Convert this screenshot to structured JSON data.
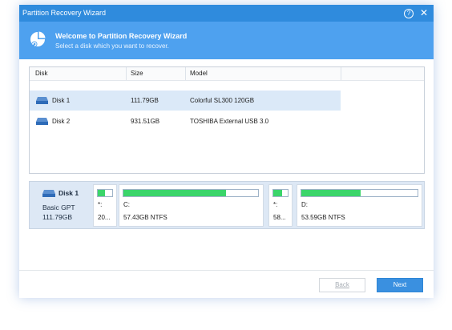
{
  "window": {
    "title": "Partition Recovery Wizard",
    "help_glyph": "?",
    "close_glyph": "✕"
  },
  "header": {
    "title": "Welcome to Partition Recovery Wizard",
    "subtitle": "Select a disk which you want to recover."
  },
  "table": {
    "columns": [
      "Disk",
      "Size",
      "Model"
    ],
    "rows": [
      {
        "disk": "Disk 1",
        "size": "111.79GB",
        "model": "Colorful SL300 120GB",
        "selected": true
      },
      {
        "disk": "Disk 2",
        "size": "931.51GB",
        "model": "TOSHIBA External USB 3.0",
        "selected": false
      }
    ]
  },
  "disk_map": {
    "name": "Disk 1",
    "type": "Basic GPT",
    "size": "111.79GB",
    "partitions": [
      {
        "label": "*:",
        "size": "20...",
        "used_fraction": 0.5
      },
      {
        "label": "C:",
        "size": "57.43GB NTFS",
        "used_fraction": 0.76
      },
      {
        "label": "*:",
        "size": "58...",
        "used_fraction": 0.6
      },
      {
        "label": "D:",
        "size": "53.59GB NTFS",
        "used_fraction": 0.51
      }
    ]
  },
  "buttons": {
    "back": "Back",
    "next": "Next"
  },
  "colors": {
    "titlebar": "#2f8bdd",
    "header": "#4ea1ef",
    "selected_row": "#dbe9f8",
    "usage_fill": "#3bd56a",
    "primary_button": "#3a90e0"
  }
}
